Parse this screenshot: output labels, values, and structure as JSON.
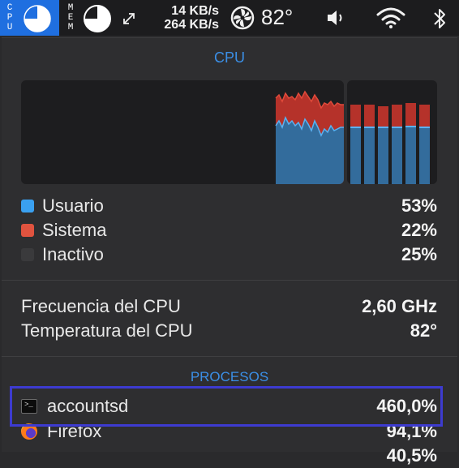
{
  "menubar": {
    "cpu_letters": [
      "C",
      "P",
      "U"
    ],
    "mem_letters": [
      "M",
      "E",
      "M"
    ],
    "net_up": "14 KB/s",
    "net_down": "264 KB/s",
    "temperature": "82°",
    "accent_color": "#1f6fe0",
    "icons": [
      "cpu-pie-icon",
      "memory-pie-icon",
      "network-arrows-icon",
      "fan-icon",
      "volume-icon",
      "wifi-icon",
      "bluetooth-icon"
    ]
  },
  "cpu": {
    "title": "CPU",
    "usage": [
      {
        "label": "Usuario",
        "value": "53%",
        "color": "#3aa0f0"
      },
      {
        "label": "Sistema",
        "value": "22%",
        "color": "#e0533f"
      },
      {
        "label": "Inactivo",
        "value": "25%",
        "color": "#3a3a3c"
      }
    ],
    "frequency_label": "Frecuencia del CPU",
    "frequency_value": "2,60 GHz",
    "temperature_label": "Temperatura del CPU",
    "temperature_value": "82°",
    "graph_colors": {
      "user": "#3a8fd8",
      "system": "#b5322a"
    }
  },
  "processes": {
    "title": "PROCESOS",
    "items": [
      {
        "name": "accountsd",
        "value": "460,0%",
        "icon": "terminal-icon"
      },
      {
        "name": "Firefox",
        "value": "94,1%",
        "icon": "firefox-icon"
      },
      {
        "name": "",
        "value": "40,5%",
        "icon": ""
      }
    ]
  }
}
